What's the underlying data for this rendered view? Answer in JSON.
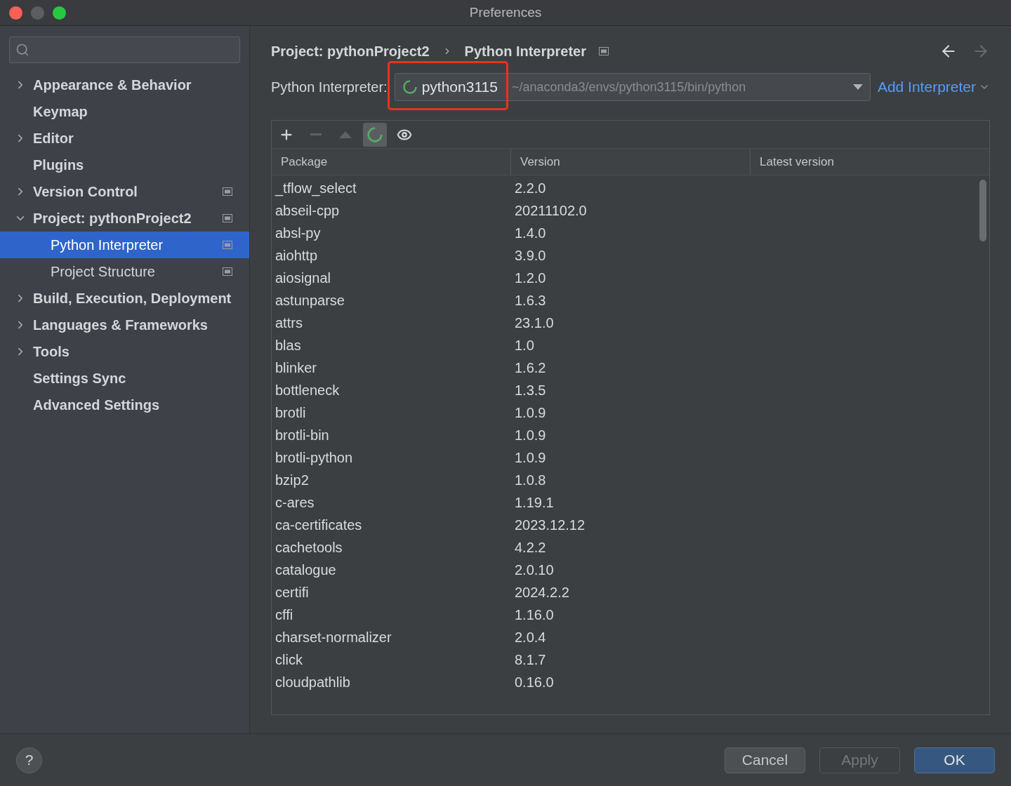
{
  "window": {
    "title": "Preferences"
  },
  "sidebar": {
    "items": [
      {
        "label": "Appearance & Behavior",
        "kind": "group",
        "expanded": false,
        "selected": false,
        "project_scoped": false
      },
      {
        "label": "Keymap",
        "kind": "page",
        "selected": false,
        "project_scoped": false
      },
      {
        "label": "Editor",
        "kind": "group",
        "expanded": false,
        "selected": false,
        "project_scoped": false
      },
      {
        "label": "Plugins",
        "kind": "page",
        "selected": false,
        "project_scoped": false
      },
      {
        "label": "Version Control",
        "kind": "group",
        "expanded": false,
        "selected": false,
        "project_scoped": true
      },
      {
        "label": "Project: pythonProject2",
        "kind": "group",
        "expanded": true,
        "selected": false,
        "project_scoped": true,
        "children": [
          {
            "label": "Python Interpreter",
            "kind": "page",
            "selected": true,
            "project_scoped": true
          },
          {
            "label": "Project Structure",
            "kind": "page",
            "selected": false,
            "project_scoped": true
          }
        ]
      },
      {
        "label": "Build, Execution, Deployment",
        "kind": "group",
        "expanded": false,
        "selected": false,
        "project_scoped": false
      },
      {
        "label": "Languages & Frameworks",
        "kind": "group",
        "expanded": false,
        "selected": false,
        "project_scoped": false
      },
      {
        "label": "Tools",
        "kind": "group",
        "expanded": false,
        "selected": false,
        "project_scoped": false
      },
      {
        "label": "Settings Sync",
        "kind": "page",
        "selected": false,
        "project_scoped": false
      },
      {
        "label": "Advanced Settings",
        "kind": "page",
        "selected": false,
        "project_scoped": false
      }
    ]
  },
  "breadcrumb": [
    "Project: pythonProject2",
    "Python Interpreter"
  ],
  "interpreter": {
    "label": "Python Interpreter:",
    "name": "python3115",
    "path": "~/anaconda3/envs/python3115/bin/python",
    "add_link": "Add Interpreter"
  },
  "toolbar": [
    {
      "kind": "add",
      "disabled": false,
      "selected": false
    },
    {
      "kind": "remove",
      "disabled": true,
      "selected": false
    },
    {
      "kind": "up",
      "disabled": true,
      "selected": false
    },
    {
      "kind": "refresh",
      "disabled": false,
      "selected": true
    },
    {
      "kind": "show",
      "disabled": false,
      "selected": false
    }
  ],
  "table": {
    "columns": [
      "Package",
      "Version",
      "Latest version"
    ],
    "rows": [
      [
        "_tflow_select",
        "2.2.0"
      ],
      [
        "abseil-cpp",
        "20211102.0"
      ],
      [
        "absl-py",
        "1.4.0"
      ],
      [
        "aiohttp",
        "3.9.0"
      ],
      [
        "aiosignal",
        "1.2.0"
      ],
      [
        "astunparse",
        "1.6.3"
      ],
      [
        "attrs",
        "23.1.0"
      ],
      [
        "blas",
        "1.0"
      ],
      [
        "blinker",
        "1.6.2"
      ],
      [
        "bottleneck",
        "1.3.5"
      ],
      [
        "brotli",
        "1.0.9"
      ],
      [
        "brotli-bin",
        "1.0.9"
      ],
      [
        "brotli-python",
        "1.0.9"
      ],
      [
        "bzip2",
        "1.0.8"
      ],
      [
        "c-ares",
        "1.19.1"
      ],
      [
        "ca-certificates",
        "2023.12.12"
      ],
      [
        "cachetools",
        "4.2.2"
      ],
      [
        "catalogue",
        "2.0.10"
      ],
      [
        "certifi",
        "2024.2.2"
      ],
      [
        "cffi",
        "1.16.0"
      ],
      [
        "charset-normalizer",
        "2.0.4"
      ],
      [
        "click",
        "8.1.7"
      ],
      [
        "cloudpathlib",
        "0.16.0"
      ]
    ]
  },
  "help": "?",
  "buttons": [
    {
      "label": "Cancel",
      "kind": "normal",
      "disabled": false
    },
    {
      "label": "Apply",
      "kind": "normal",
      "disabled": true
    },
    {
      "label": "OK",
      "kind": "default",
      "disabled": false
    }
  ]
}
